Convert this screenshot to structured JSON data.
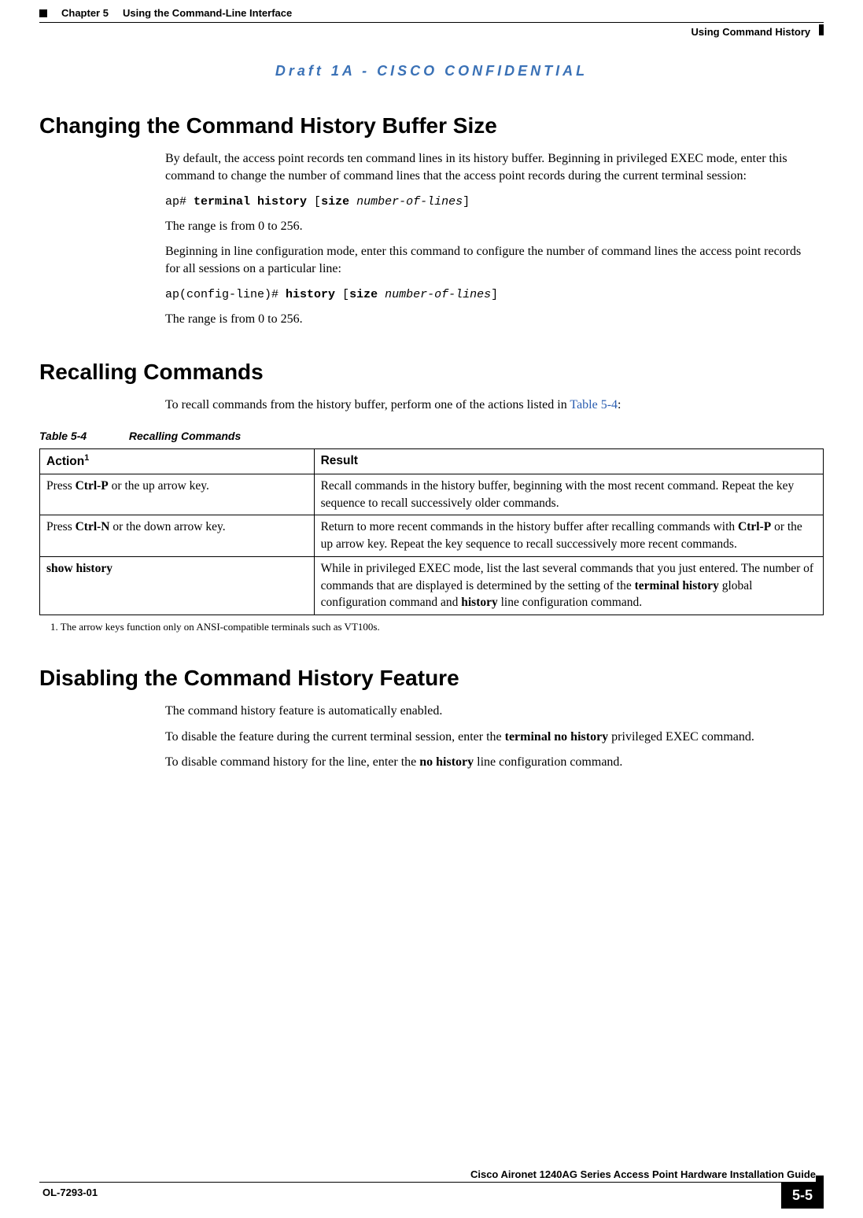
{
  "header": {
    "chapter_label": "Chapter 5",
    "chapter_title": "Using the Command-Line Interface",
    "section_label": "Using Command History"
  },
  "confidential_banner": "Draft 1A - CISCO CONFIDENTIAL",
  "sections": {
    "changing": {
      "heading": "Changing the Command History Buffer Size",
      "p1": "By default, the access point records ten command lines in its history buffer. Beginning in privileged EXEC mode, enter this command to change the number of command lines that the access point records during the current terminal session:",
      "cmd1": {
        "prompt": "ap# ",
        "bold1": "terminal history",
        "plain1": " [",
        "bold2": "size",
        "plain2": " ",
        "italic": "number-of-lines",
        "plain3": "]"
      },
      "p2": "The range is from 0 to 256.",
      "p3": "Beginning in line configuration mode, enter this command to configure the number of command lines the access point records for all sessions on a particular line:",
      "cmd2": {
        "prompt": "ap(config-line)# ",
        "bold1": "history",
        "plain1": " [",
        "bold2": "size",
        "plain2": " ",
        "italic": "number-of-lines",
        "plain3": "]"
      },
      "p4": "The range is from 0 to 256."
    },
    "recalling": {
      "heading": "Recalling Commands",
      "intro_pre": "To recall commands from the history buffer, perform one of the actions listed in ",
      "intro_link": "Table 5-4",
      "intro_post": ":",
      "table_id": "Table 5-4",
      "table_title": "Recalling Commands",
      "columns": {
        "action": "Action",
        "action_sup": "1",
        "result": "Result"
      },
      "rows": [
        {
          "action_pre": "Press ",
          "action_bold": "Ctrl-P",
          "action_post": " or the up arrow key.",
          "result": "Recall commands in the history buffer, beginning with the most recent command. Repeat the key sequence to recall successively older commands."
        },
        {
          "action_pre": "Press ",
          "action_bold": "Ctrl-N",
          "action_post": " or the down arrow key.",
          "result_pre": "Return to more recent commands in the history buffer after recalling commands with ",
          "result_bold": "Ctrl-P",
          "result_post": " or the up arrow key. Repeat the key sequence to recall successively more recent commands."
        },
        {
          "action_bold": "show history",
          "result_pre": "While in privileged EXEC mode, list the last several commands that you just entered. The number of commands that are displayed is determined by the setting of the ",
          "result_bold1": "terminal history",
          "result_mid": " global configuration command and ",
          "result_bold2": "history",
          "result_post": " line configuration command."
        }
      ],
      "footnote": "1.   The arrow keys function only on ANSI-compatible terminals such as VT100s."
    },
    "disabling": {
      "heading": "Disabling the Command History Feature",
      "p1": "The command history feature is automatically enabled.",
      "p2_pre": "To disable the feature during the current terminal session, enter the ",
      "p2_bold": "terminal no history",
      "p2_post": " privileged EXEC command.",
      "p3_pre": "To disable command history for the line, enter the ",
      "p3_bold": "no history",
      "p3_post": " line configuration command."
    }
  },
  "footer": {
    "guide_title": "Cisco Aironet 1240AG Series Access Point Hardware Installation Guide",
    "doc_id": "OL-7293-01",
    "page_number": "5-5"
  }
}
